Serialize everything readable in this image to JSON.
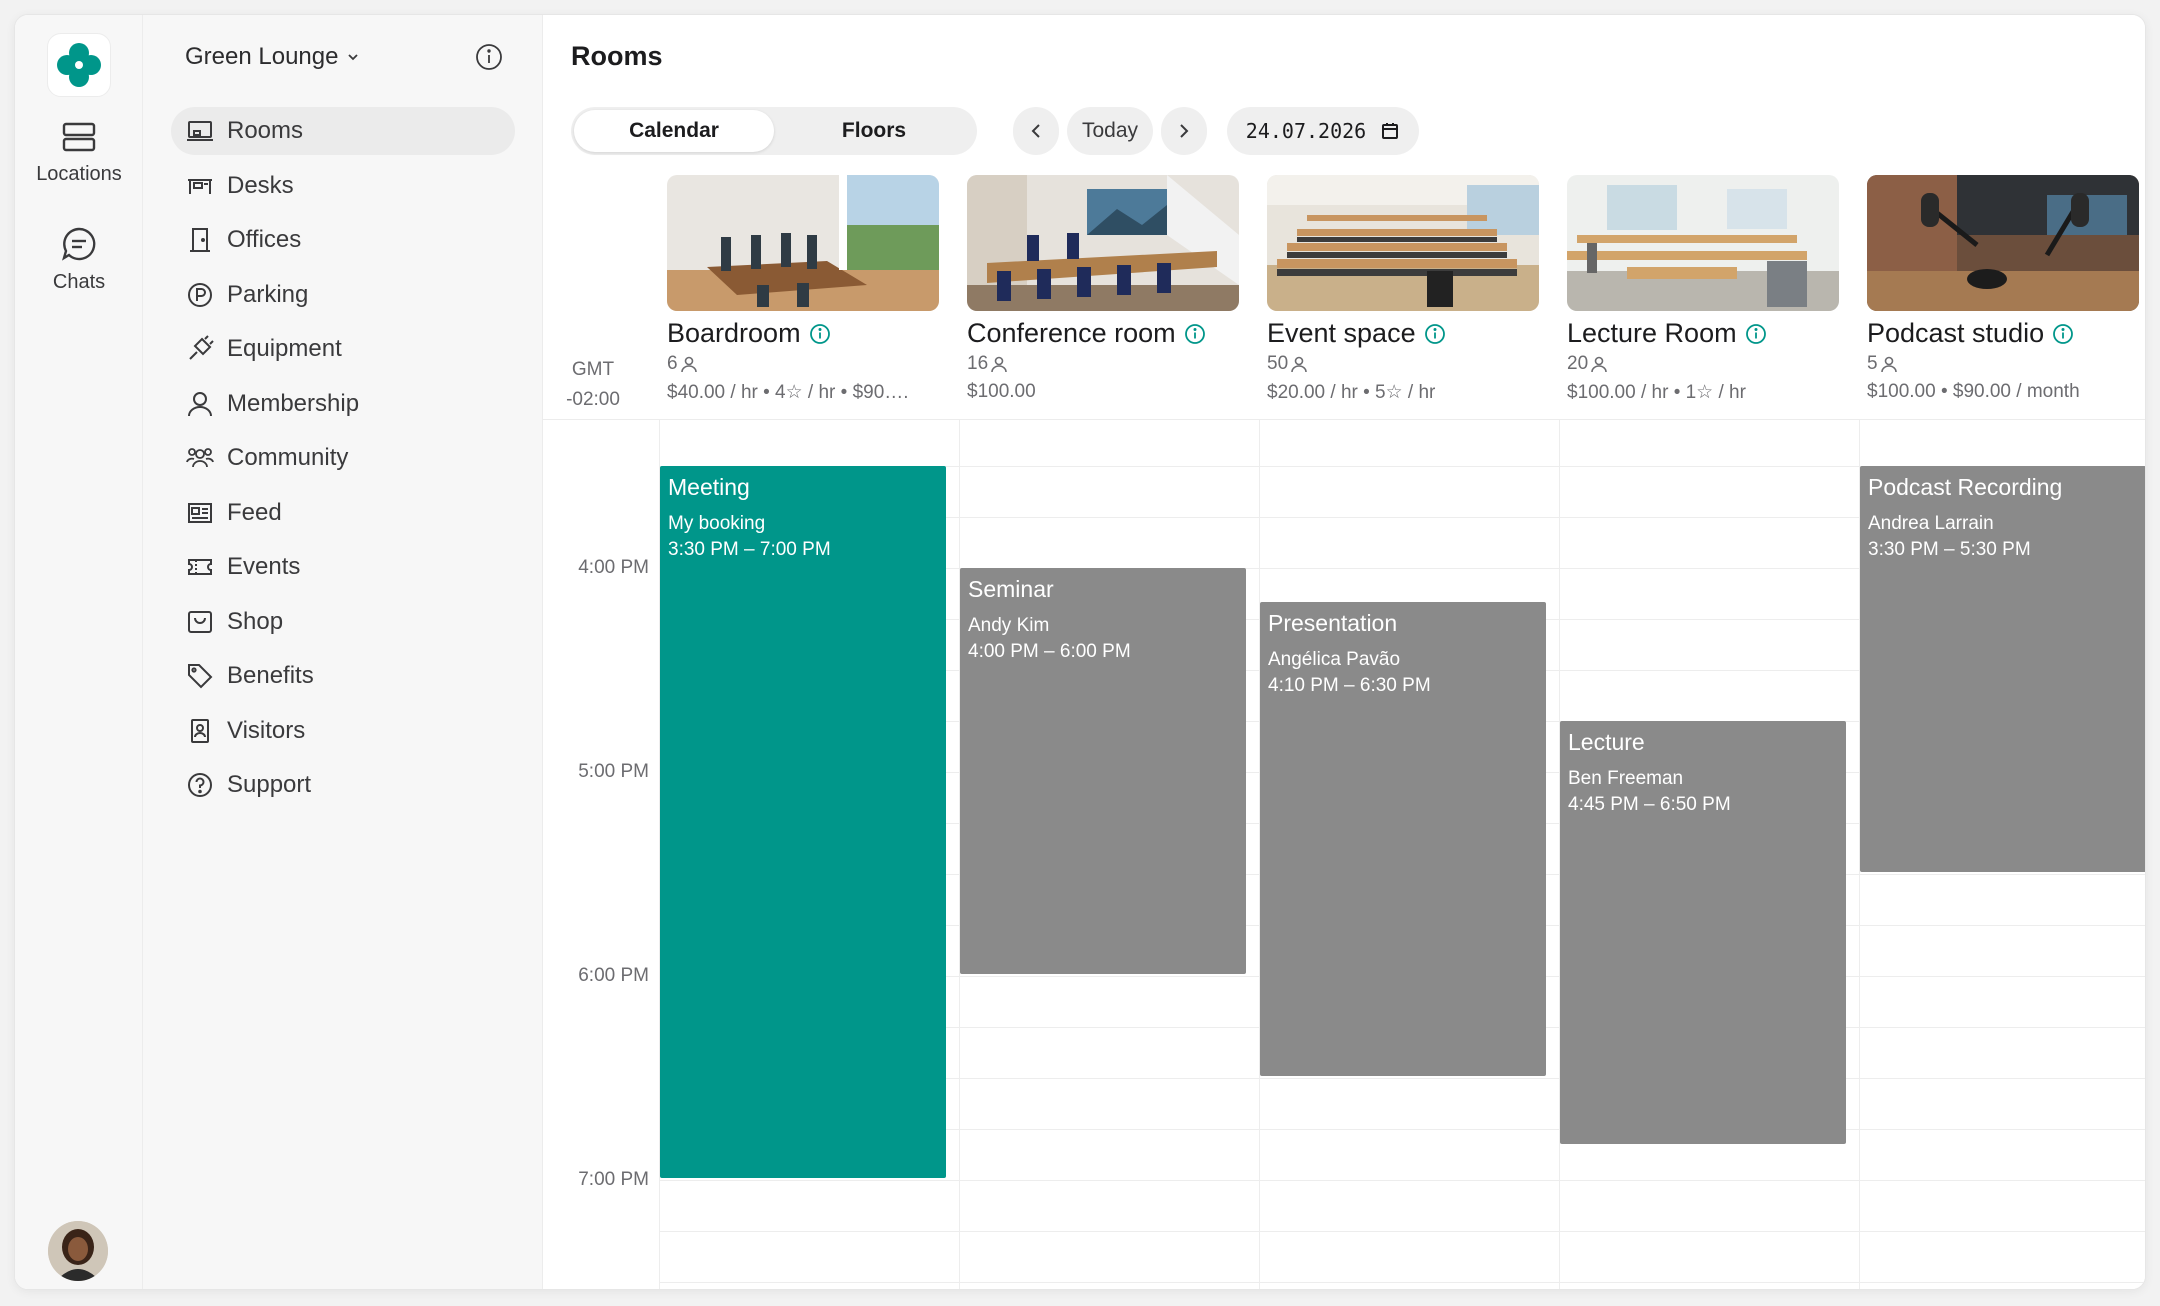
{
  "rail": {
    "items": [
      {
        "label": "Locations",
        "icon": "locations-icon"
      },
      {
        "label": "Chats",
        "icon": "chat-bubble-icon"
      }
    ]
  },
  "sidebar": {
    "workspace": "Green Lounge",
    "items": [
      {
        "label": "Rooms",
        "icon": "room-icon",
        "active": true
      },
      {
        "label": "Desks",
        "icon": "desk-icon"
      },
      {
        "label": "Offices",
        "icon": "door-icon"
      },
      {
        "label": "Parking",
        "icon": "parking-icon"
      },
      {
        "label": "Equipment",
        "icon": "plug-icon"
      },
      {
        "label": "Membership",
        "icon": "person-icon"
      },
      {
        "label": "Community",
        "icon": "people-icon"
      },
      {
        "label": "Feed",
        "icon": "newspaper-icon"
      },
      {
        "label": "Events",
        "icon": "ticket-icon"
      },
      {
        "label": "Shop",
        "icon": "shop-icon"
      },
      {
        "label": "Benefits",
        "icon": "tag-icon"
      },
      {
        "label": "Visitors",
        "icon": "badge-icon"
      },
      {
        "label": "Support",
        "icon": "question-icon"
      }
    ]
  },
  "main": {
    "title": "Rooms",
    "tabs": [
      {
        "label": "Calendar",
        "active": true
      },
      {
        "label": "Floors",
        "active": false
      }
    ],
    "today_label": "Today",
    "date": "24.07.2026",
    "timezone": [
      "GMT",
      "-02:00"
    ],
    "time_labels": [
      "4:00 PM",
      "5:00 PM",
      "6:00 PM",
      "7:00 PM"
    ],
    "rooms": [
      {
        "name": "Boardroom",
        "capacity": "6",
        "price": "$40.00 / hr • 4☆ / hr • $90…."
      },
      {
        "name": "Conference room",
        "capacity": "16",
        "price": "$100.00"
      },
      {
        "name": "Event space",
        "capacity": "50",
        "price": "$20.00 / hr • 5☆ / hr"
      },
      {
        "name": "Lecture Room",
        "capacity": "20",
        "price": "$100.00 / hr • 1☆ / hr"
      },
      {
        "name": "Podcast studio",
        "capacity": "5",
        "price": "$100.00 • $90.00 / month"
      }
    ],
    "events": [
      {
        "title": "Meeting",
        "person": "My booking",
        "time": "3:30 PM – 7:00 PM",
        "mine": true
      },
      {
        "title": "Seminar",
        "person": "Andy Kim",
        "time": "4:00 PM – 6:00 PM",
        "mine": false
      },
      {
        "title": "Presentation",
        "person": "Angélica Pavão",
        "time": "4:10 PM – 6:30 PM",
        "mine": false
      },
      {
        "title": "Lecture",
        "person": "Ben Freeman",
        "time": "4:45 PM – 6:50 PM",
        "mine": false
      },
      {
        "title": "Podcast Recording",
        "person": "Andrea Larrain",
        "time": "3:30 PM – 5:30 PM",
        "mine": false
      }
    ]
  },
  "colors": {
    "accent": "#00968a",
    "event_gray": "#8a8a8a",
    "info": "#00968a"
  }
}
